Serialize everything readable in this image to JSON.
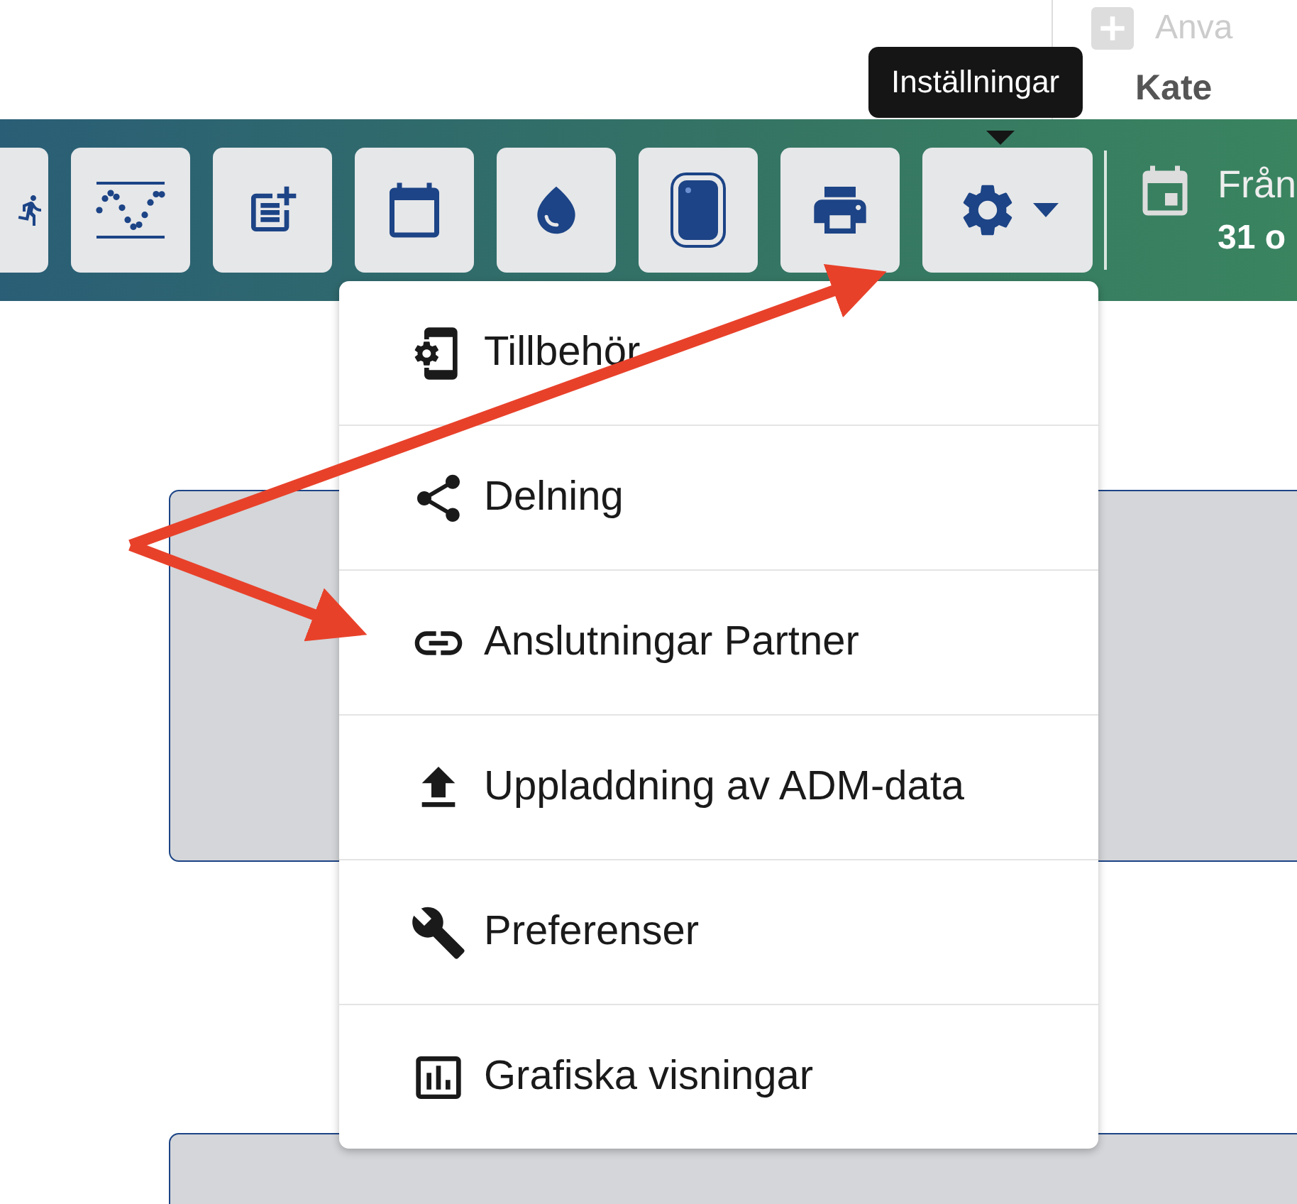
{
  "side_panel": {
    "line_1": "Anva",
    "line_2": "Kate"
  },
  "toolbar": {
    "tooltip": "Inställningar",
    "date_range": {
      "label": "Från",
      "value": "31 o"
    }
  },
  "settings_menu": {
    "expanded": true,
    "items": [
      {
        "label": "Tillbehör"
      },
      {
        "label": "Delning"
      },
      {
        "label": "Anslutningar Partner"
      },
      {
        "label": "Uppladdning av ADM-data"
      },
      {
        "label": "Preferenser"
      },
      {
        "label": "Grafiska visningar"
      }
    ]
  }
}
